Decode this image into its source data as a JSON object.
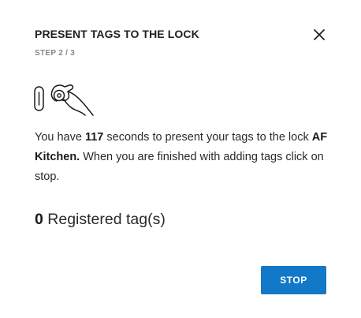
{
  "dialog": {
    "title": "PRESENT TAGS TO THE LOCK",
    "step": "STEP 2 / 3",
    "close_icon": "close-icon",
    "illustration_icon": "hand-present-tag-icon"
  },
  "message": {
    "prefix": "You have ",
    "seconds": "117",
    "middle": " seconds to present your tags to the lock ",
    "lock_name": "AF Kitchen.",
    "suffix": " When you are finished with adding tags click on stop."
  },
  "registered": {
    "count": "0",
    "label": " Registered tag(s)"
  },
  "actions": {
    "stop_label": "STOP"
  },
  "colors": {
    "accent": "#1179c7",
    "step_text": "#888888"
  }
}
